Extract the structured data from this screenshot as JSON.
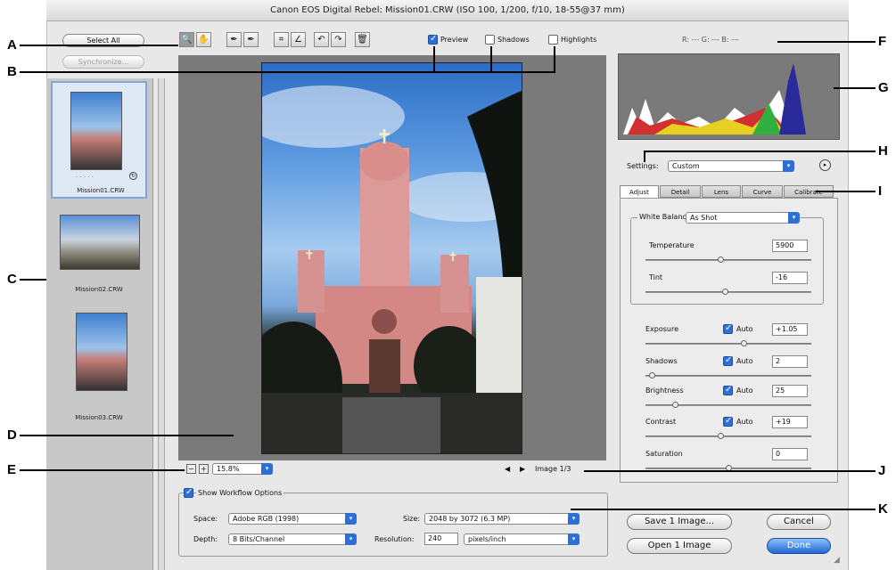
{
  "window": {
    "title": "Canon EOS Digital Rebel: Mission01.CRW (ISO 100, 1/200, f/10, 18-55@37 mm)"
  },
  "left_buttons": {
    "select_all": "Select All",
    "synchronize": "Synchronize..."
  },
  "filmstrip": {
    "items": [
      {
        "name": "Mission01.CRW",
        "rating": "· · · · ·"
      },
      {
        "name": "Mission02.CRW"
      },
      {
        "name": "Mission03.CRW"
      }
    ]
  },
  "toolbar": {
    "tools": [
      "zoom-icon",
      "hand-icon",
      "eyedropper-icon",
      "color-sampler-icon",
      "crop-icon",
      "straighten-icon",
      "rotate-left-icon",
      "rotate-right-icon",
      "trash-icon"
    ],
    "tool_glyphs": [
      "🔍",
      "✋",
      "✒",
      "✒",
      "⌗",
      "∠",
      "↶",
      "↷",
      "🗑"
    ]
  },
  "preview_options": {
    "preview": "Preview",
    "shadows": "Shadows",
    "highlights": "Highlights"
  },
  "rgb_readout": "R: ---   G: ---   B: ---",
  "zoom": {
    "value": "15.8%",
    "minus": "−",
    "plus": "+"
  },
  "image_nav": {
    "label": "Image 1/3",
    "prev": "◀",
    "next": "▶"
  },
  "settings": {
    "label": "Settings:",
    "value": "Custom"
  },
  "tabs": [
    "Adjust",
    "Detail",
    "Lens",
    "Curve",
    "Calibrate"
  ],
  "white_balance": {
    "label": "White Balance:",
    "value": "As Shot"
  },
  "adjust": {
    "temperature": {
      "label": "Temperature",
      "value": "5900",
      "level": 0.45
    },
    "tint": {
      "label": "Tint",
      "value": "-16",
      "level": 0.48
    },
    "exposure": {
      "label": "Exposure",
      "auto": "Auto",
      "value": "+1.05",
      "level": 0.6
    },
    "shadows": {
      "label": "Shadows",
      "auto": "Auto",
      "value": "2",
      "level": 0.02
    },
    "brightness": {
      "label": "Brightness",
      "auto": "Auto",
      "value": "25",
      "level": 0.17
    },
    "contrast": {
      "label": "Contrast",
      "auto": "Auto",
      "value": "+19",
      "level": 0.45
    },
    "saturation": {
      "label": "Saturation",
      "value": "0",
      "level": 0.5
    }
  },
  "workflow": {
    "toggle": "Show Workflow Options",
    "space_label": "Space:",
    "space_value": "Adobe RGB (1998)",
    "depth_label": "Depth:",
    "depth_value": "8 Bits/Channel",
    "size_label": "Size:",
    "size_value": "2048 by 3072 (6.3 MP)",
    "resolution_label": "Resolution:",
    "resolution_value": "240",
    "resolution_unit": "pixels/inch"
  },
  "buttons": {
    "save": "Save 1 Image...",
    "open": "Open 1 Image",
    "cancel": "Cancel",
    "done": "Done"
  },
  "callouts": [
    "A",
    "B",
    "C",
    "D",
    "E",
    "F",
    "G",
    "H",
    "I",
    "J",
    "K"
  ],
  "colors": {
    "accent": "#2d6fd6",
    "selection": "#7ea6d8"
  }
}
